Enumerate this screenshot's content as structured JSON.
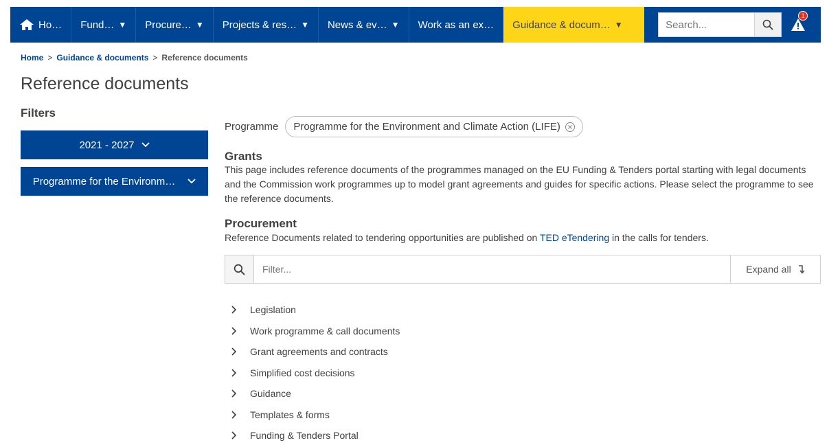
{
  "nav": {
    "items": [
      {
        "label": "Ho…",
        "caret": false,
        "active": false
      },
      {
        "label": "Fund…",
        "caret": true,
        "active": false
      },
      {
        "label": "Procure…",
        "caret": true,
        "active": false
      },
      {
        "label": "Projects & res…",
        "caret": true,
        "active": false
      },
      {
        "label": "News & ev…",
        "caret": true,
        "active": false
      },
      {
        "label": "Work as an ex…",
        "caret": false,
        "active": false
      },
      {
        "label": "Guidance & docum…",
        "caret": true,
        "active": true
      }
    ],
    "search_placeholder": "Search...",
    "alert_count": "1"
  },
  "breadcrumb": {
    "home": "Home",
    "parent": "Guidance & documents",
    "current": "Reference documents",
    "separator": ">"
  },
  "page": {
    "title": "Reference documents"
  },
  "filters": {
    "title": "Filters",
    "period": "2021 - 2027",
    "programme": "Programme for the Environm…"
  },
  "programme_filter": {
    "label": "Programme",
    "chip": "Programme for the Environment and Climate Action (LIFE)"
  },
  "grants": {
    "title": "Grants",
    "text": "This page includes reference documents of the programmes managed on the EU Funding & Tenders portal starting with legal documents and the Commission work programmes up to model grant agreements and guides for specific actions. Please select the programme to see the reference documents."
  },
  "procurement": {
    "title": "Procurement",
    "text_before": "Reference Documents related to tendering opportunities are published on ",
    "link": "TED eTendering",
    "text_after": " in the calls for tenders."
  },
  "doc_filter": {
    "placeholder": "Filter...",
    "expand_label": "Expand all"
  },
  "accordion": [
    "Legislation",
    "Work programme & call documents",
    "Grant agreements and contracts",
    "Simplified cost decisions",
    "Guidance",
    "Templates & forms",
    "Funding & Tenders Portal"
  ],
  "colors": {
    "nav_bg": "#004494",
    "active_bg": "#ffd617",
    "link": "#004494",
    "badge": "#e0301e"
  }
}
